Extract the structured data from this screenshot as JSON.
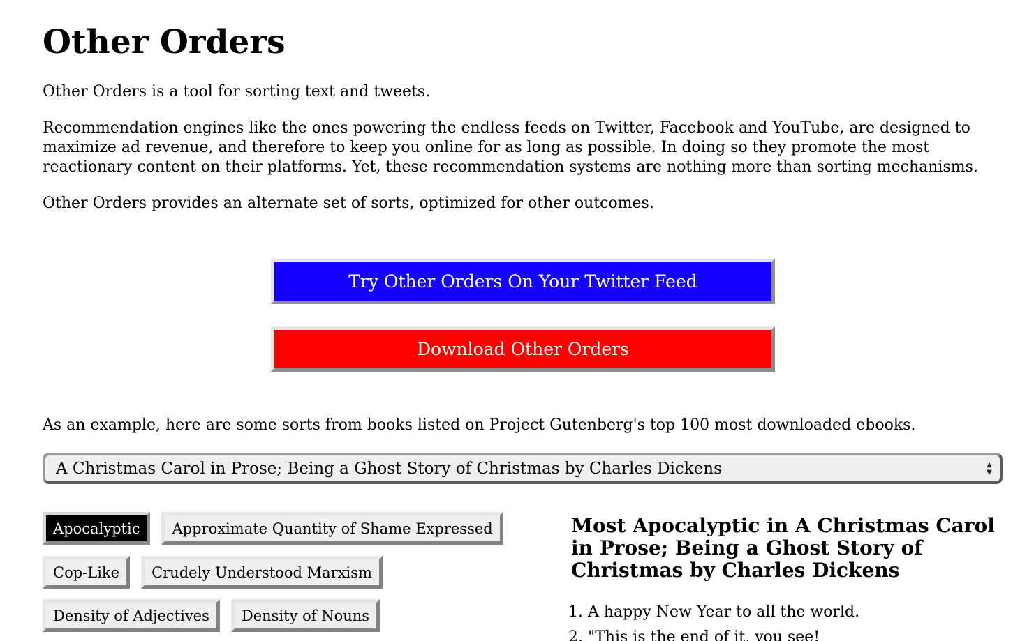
{
  "header": {
    "title": "Other Orders"
  },
  "intro": {
    "p1": "Other Orders is a tool for sorting text and tweets.",
    "p2": "Recommendation engines like the ones powering the endless feeds on Twitter, Facebook and YouTube, are designed to maximize ad revenue, and therefore to keep you online for as long as possible. In doing so they promote the most reactionary content on their platforms. Yet, these recommendation systems are nothing more than sorting mechanisms.",
    "p3": "Other Orders provides an alternate set of sorts, optimized for other outcomes."
  },
  "actions": {
    "twitter_label": "Try Other Orders On Your Twitter Feed",
    "twitter_color": "#1500ff",
    "download_label": "Download Other Orders",
    "download_color": "#ff0000"
  },
  "example": {
    "description": "As an example, here are some sorts from books listed on Project Gutenberg's top 100 most downloaded ebooks.",
    "book_select_value": "A Christmas Carol in Prose; Being a Ghost Story of Christmas by Charles Dickens"
  },
  "sorts": {
    "items": [
      {
        "label": "Apocalyptic",
        "active": true
      },
      {
        "label": "Approximate Quantity of Shame Expressed",
        "active": false
      },
      {
        "label": "Cop-Like",
        "active": false
      },
      {
        "label": "Crudely Understood Marxism",
        "active": false
      },
      {
        "label": "Density of Adjectives",
        "active": false
      },
      {
        "label": "Density of Nouns",
        "active": false
      }
    ]
  },
  "results": {
    "title": "Most Apocalyptic in A Christmas Carol in Prose; Being a Ghost Story of Christmas by Charles Dickens",
    "items": [
      "A happy New Year to all the world.",
      "\"This is the end of it, you see!"
    ]
  }
}
